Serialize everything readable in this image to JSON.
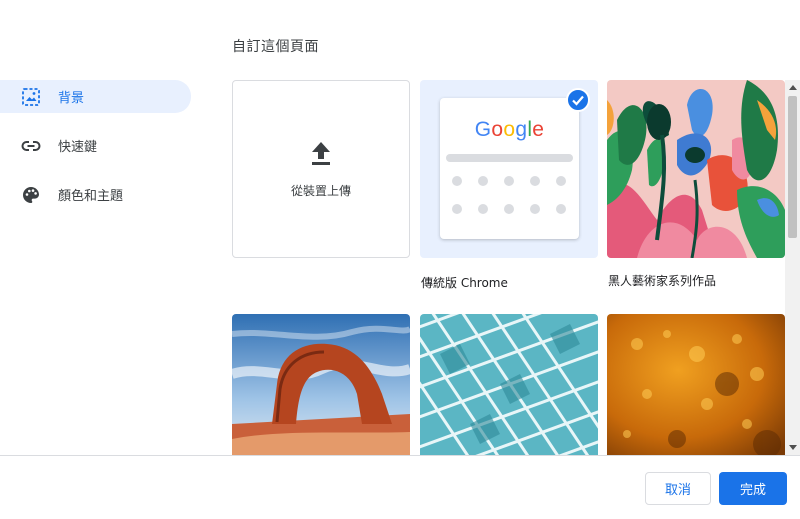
{
  "dialog": {
    "title": "自訂這個頁面"
  },
  "sidebar": {
    "items": [
      {
        "label": "背景",
        "icon": "image-icon",
        "active": true
      },
      {
        "label": "快速鍵",
        "icon": "link-icon",
        "active": false
      },
      {
        "label": "顏色和主題",
        "icon": "palette-icon",
        "active": false
      }
    ]
  },
  "tiles": {
    "upload": {
      "label": "從裝置上傳",
      "icon": "upload-icon"
    },
    "classic": {
      "caption": "傳統版 Chrome",
      "logo": "Google",
      "selected": true
    },
    "black_art": {
      "caption": "黑人藝術家系列作品"
    },
    "row2": [
      {
        "subject": "red rock arch under blue sky"
      },
      {
        "subject": "teal geometric architecture"
      },
      {
        "subject": "orange autumn texture"
      }
    ]
  },
  "footer": {
    "cancel_label": "取消",
    "done_label": "完成"
  },
  "colors": {
    "accent": "#1a73e8",
    "active_bg": "#e8f0fe",
    "divider": "#dadce0"
  }
}
